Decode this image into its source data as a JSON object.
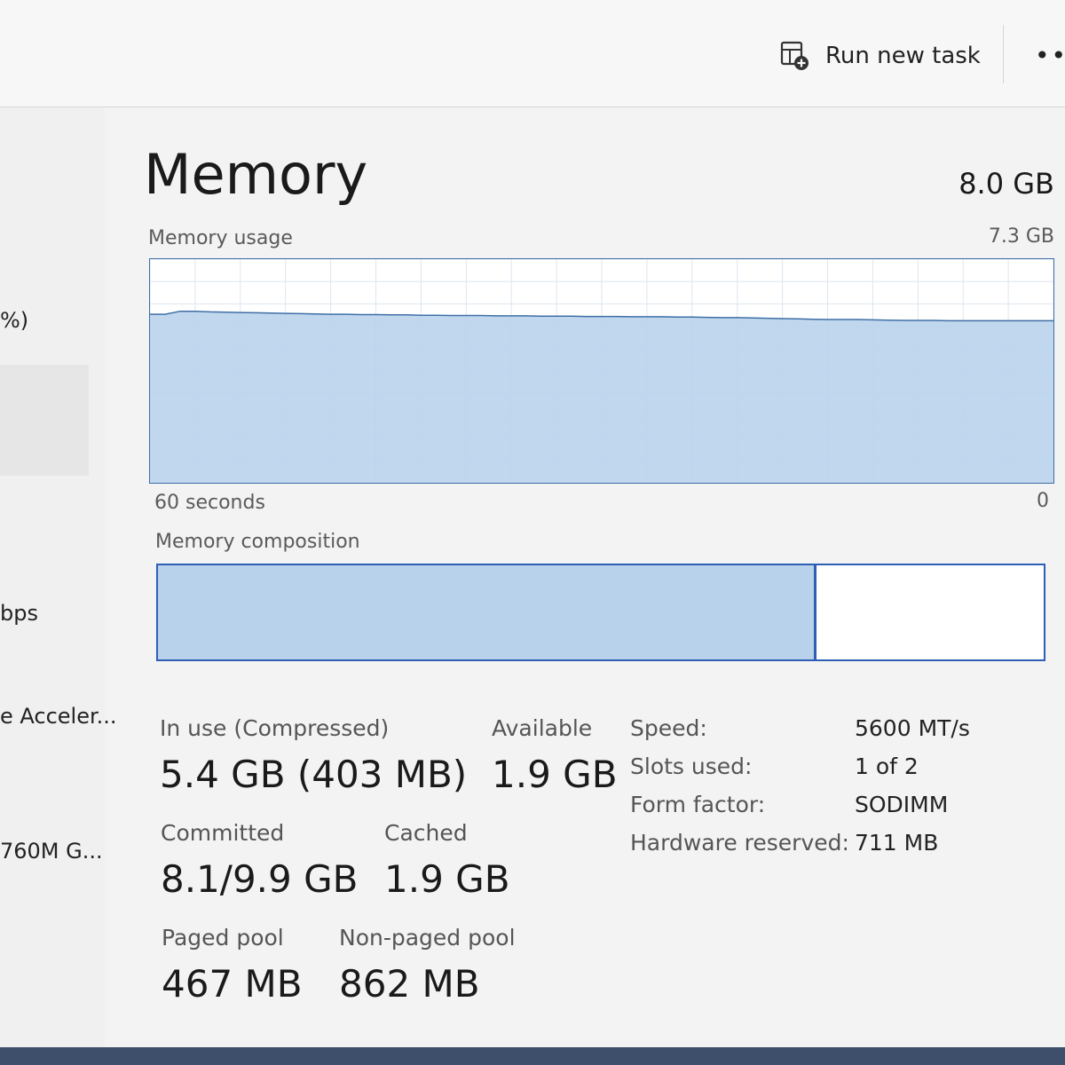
{
  "toolbar": {
    "run_new_task_label": "Run new task",
    "more_label": "•••"
  },
  "sidebar": {
    "items": [
      {
        "label": "%)"
      },
      {
        "label": "bps"
      },
      {
        "label": "e Acceler..."
      },
      {
        "label": " 760M G..."
      }
    ]
  },
  "header": {
    "title": "Memory",
    "total": "8.0 GB"
  },
  "usage_graph": {
    "label": "Memory usage",
    "max_label": "7.3 GB",
    "time_left": "60 seconds",
    "time_right": "0",
    "fill_color": "#b9d3ec",
    "line_color": "#3f6fa6",
    "usage_series_gb": [
      5.5,
      5.5,
      5.6,
      5.6,
      5.58,
      5.57,
      5.56,
      5.55,
      5.54,
      5.53,
      5.52,
      5.51,
      5.5,
      5.5,
      5.49,
      5.49,
      5.48,
      5.48,
      5.47,
      5.47,
      5.46,
      5.46,
      5.46,
      5.45,
      5.45,
      5.45,
      5.44,
      5.44,
      5.44,
      5.43,
      5.43,
      5.43,
      5.42,
      5.42,
      5.42,
      5.41,
      5.41,
      5.4,
      5.39,
      5.39,
      5.38,
      5.37,
      5.36,
      5.35,
      5.34,
      5.33,
      5.33,
      5.33,
      5.32,
      5.31,
      5.3,
      5.3,
      5.3,
      5.29,
      5.29,
      5.29,
      5.29,
      5.29,
      5.29,
      5.29,
      5.29
    ]
  },
  "composition": {
    "label": "Memory composition",
    "in_use_fraction": 0.74,
    "in_use_color": "#b7d2ea",
    "border_color": "#2e5fb4"
  },
  "stats": {
    "in_use_label": "In use (Compressed)",
    "in_use_value": "5.4 GB (403 MB)",
    "available_label": "Available",
    "available_value": "1.9 GB",
    "committed_label": "Committed",
    "committed_value": "8.1/9.9 GB",
    "cached_label": "Cached",
    "cached_value": "1.9 GB",
    "paged_label": "Paged pool",
    "paged_value": "467 MB",
    "nonpaged_label": "Non-paged pool",
    "nonpaged_value": "862 MB"
  },
  "properties": [
    {
      "label": "Speed:",
      "value": "5600 MT/s"
    },
    {
      "label": "Slots used:",
      "value": "1 of 2"
    },
    {
      "label": "Form factor:",
      "value": "SODIMM"
    },
    {
      "label": "Hardware reserved:",
      "value": "711 MB"
    }
  ]
}
